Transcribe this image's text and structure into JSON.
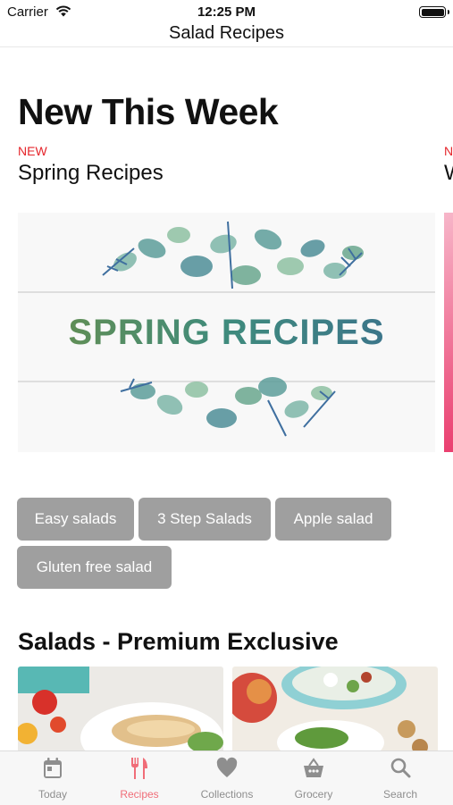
{
  "status_bar": {
    "carrier": "Carrier",
    "time": "12:25 PM"
  },
  "nav": {
    "title": "Salad Recipes"
  },
  "main": {
    "section_title": "New This Week",
    "featured": {
      "tag": "NEW",
      "title": "Spring Recipes",
      "image_text": "SPRING RECIPES"
    },
    "next_featured": {
      "tag": "N",
      "title": "W"
    },
    "chips": [
      "Easy salads",
      "3 Step Salads",
      "Apple salad",
      "Gluten free salad"
    ],
    "section2_title": "Salads - Premium Exclusive"
  },
  "tabbar": {
    "items": [
      {
        "label": "Today",
        "icon": "calendar-icon",
        "active": false
      },
      {
        "label": "Recipes",
        "icon": "fork-knife-icon",
        "active": true
      },
      {
        "label": "Collections",
        "icon": "heart-icon",
        "active": false
      },
      {
        "label": "Grocery",
        "icon": "basket-icon",
        "active": false
      },
      {
        "label": "Search",
        "icon": "search-icon",
        "active": false
      }
    ]
  },
  "colors": {
    "accent": "#f06d78",
    "new_tag": "#e5252b",
    "chip_bg": "#9f9f9f"
  }
}
